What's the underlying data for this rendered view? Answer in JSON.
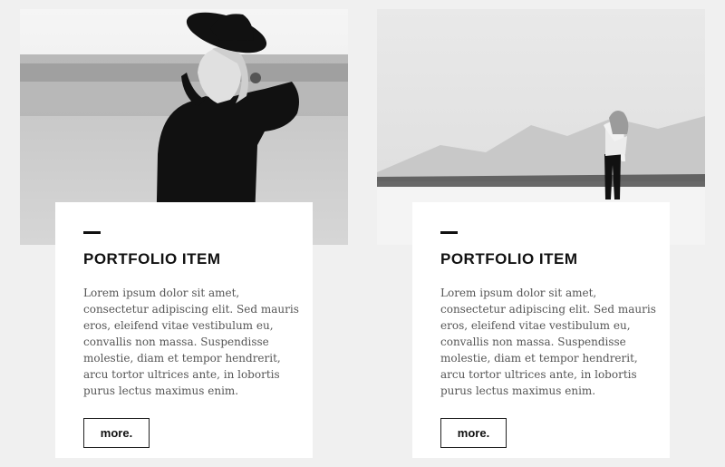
{
  "cards": [
    {
      "title": "PORTFOLIO ITEM",
      "description": "Lorem ipsum dolor sit amet, consectetur adipiscing elit. Sed mauris eros, eleifend vitae vestibulum eu, convallis non massa. Suspendisse molestie, diam et tempor hendrerit, arcu tortor ultrices ante, in lobortis purus lectus maximus enim.",
      "button_label": "more.",
      "image": "woman-in-hat-photo"
    },
    {
      "title": "PORTFOLIO ITEM",
      "description": "Lorem ipsum dolor sit amet, consectetur adipiscing elit. Sed mauris eros, eleifend vitae vestibulum eu, convallis non massa. Suspendisse molestie, diam et tempor hendrerit, arcu tortor ultrices ante, in lobortis purus lectus maximus enim.",
      "button_label": "more.",
      "image": "woman-in-snow-photo"
    }
  ],
  "colors": {
    "background": "#f0f0f0",
    "card": "#ffffff",
    "text_dark": "#111111",
    "text_body": "#555555"
  }
}
